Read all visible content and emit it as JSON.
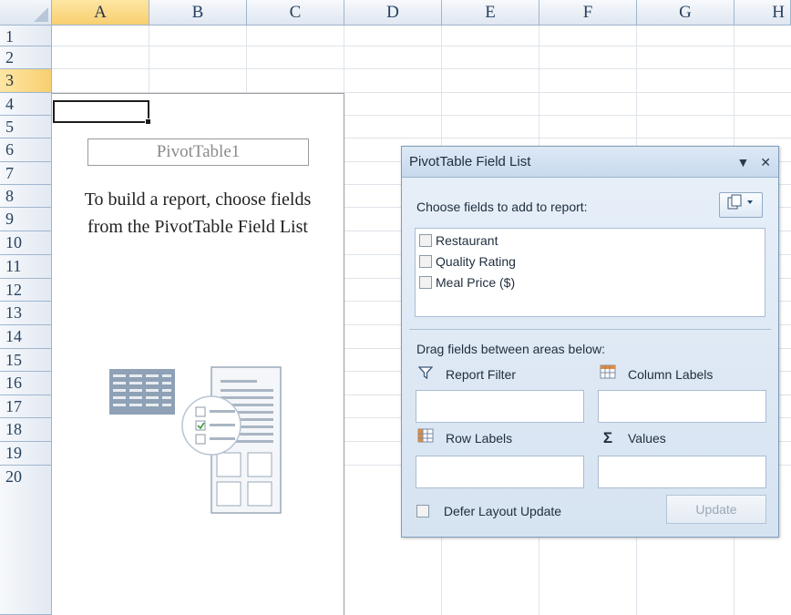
{
  "sheet": {
    "columns": [
      "A",
      "B",
      "C",
      "D",
      "E",
      "F",
      "G",
      "H"
    ],
    "rows": [
      "1",
      "2",
      "3",
      "4",
      "5",
      "6",
      "7",
      "8",
      "9",
      "10",
      "11",
      "12",
      "13",
      "14",
      "15",
      "16",
      "17",
      "18",
      "19",
      "20"
    ],
    "selected_column": "A",
    "selected_row": "3"
  },
  "pivot": {
    "name": "PivotTable1",
    "instruction_line1": "To build a report, choose fields",
    "instruction_line2": "from the PivotTable Field List"
  },
  "field_list_panel": {
    "title": "PivotTable Field List",
    "dropdown_glyph": "▼",
    "close_glyph": "✕",
    "choose_label": "Choose fields to add to report:",
    "fields": [
      {
        "label": "Restaurant",
        "checked": false
      },
      {
        "label": "Quality Rating",
        "checked": false
      },
      {
        "label": "Meal Price ($)",
        "checked": false
      }
    ],
    "drag_label": "Drag fields between areas below:",
    "areas": {
      "report_filter": "Report Filter",
      "column_labels": "Column Labels",
      "row_labels": "Row Labels",
      "values": "Values"
    },
    "icons": {
      "report_filter": "funnel-icon",
      "column_labels": "column-grid-icon",
      "row_labels": "row-grid-icon",
      "values": "sigma-icon"
    },
    "defer_label": "Defer Layout Update",
    "update_label": "Update"
  },
  "colors": {
    "header_fill": "#dfe7f1",
    "selected_header_fill": "#f8cf6f",
    "panel_fill": "#d6e3f1",
    "panel_border": "#7f9db9"
  }
}
